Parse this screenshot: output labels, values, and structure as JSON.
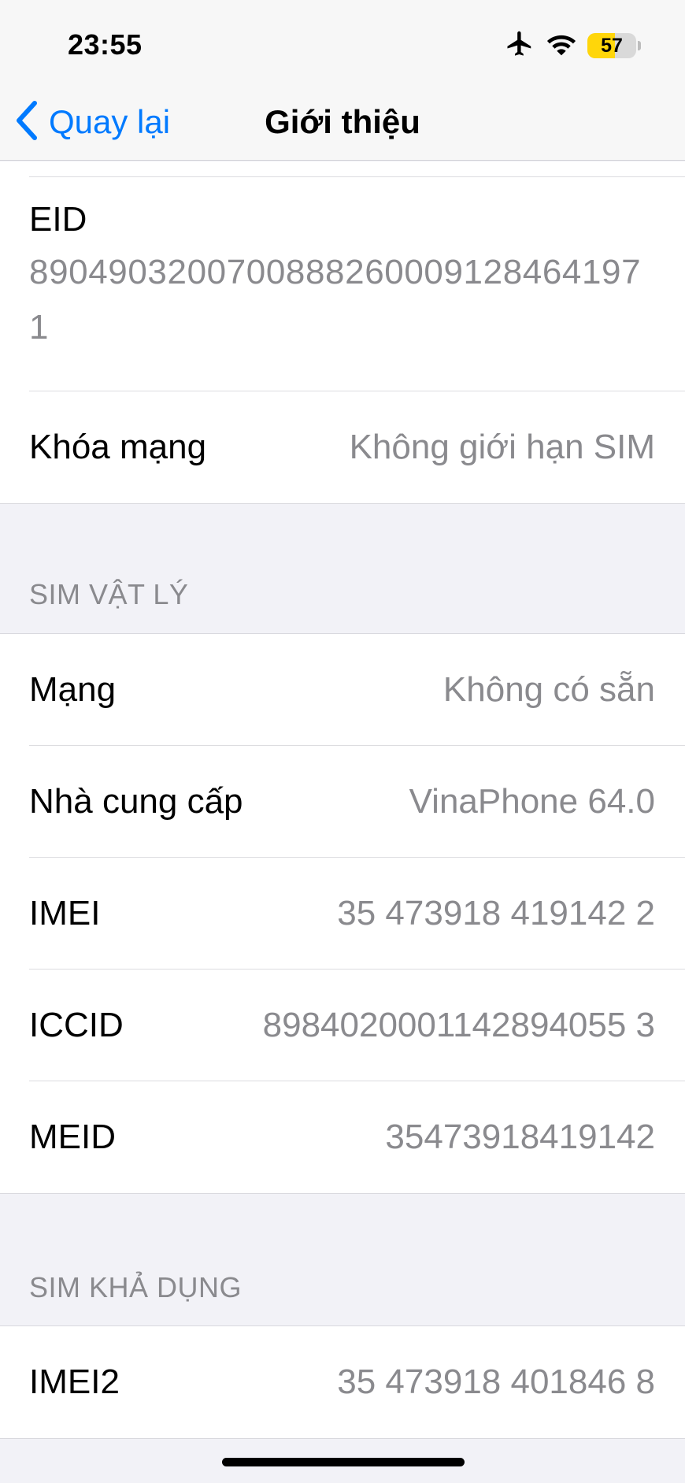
{
  "status_bar": {
    "time": "23:55",
    "battery_level": "57",
    "battery_fraction": 0.57,
    "icons": [
      "airplane-icon",
      "wifi-icon",
      "battery-icon"
    ]
  },
  "nav": {
    "back_label": "Quay lại",
    "title": "Giới thiệu"
  },
  "top_group": {
    "eid_label": "EID",
    "eid_value": "89049032007008882600091284641971",
    "network_lock_label": "Khóa mạng",
    "network_lock_value": "Không giới hạn SIM"
  },
  "physical_sim": {
    "header": "SIM VẬT LÝ",
    "rows": [
      {
        "label": "Mạng",
        "value": "Không có sẵn"
      },
      {
        "label": "Nhà cung cấp",
        "value": "VinaPhone 64.0"
      },
      {
        "label": "IMEI",
        "value": "35 473918 419142 2"
      },
      {
        "label": "ICCID",
        "value": "8984020001142894055 3"
      },
      {
        "label": "MEID",
        "value": "35473918419142"
      }
    ]
  },
  "available_sim": {
    "header": "SIM KHẢ DỤNG",
    "rows": [
      {
        "label": "IMEI2",
        "value": "35 473918 401846 8"
      }
    ]
  },
  "colors": {
    "accent": "#007aff",
    "secondary_text": "#8a8a8e",
    "background": "#f2f2f7",
    "battery_fill": "#ffd60a"
  }
}
